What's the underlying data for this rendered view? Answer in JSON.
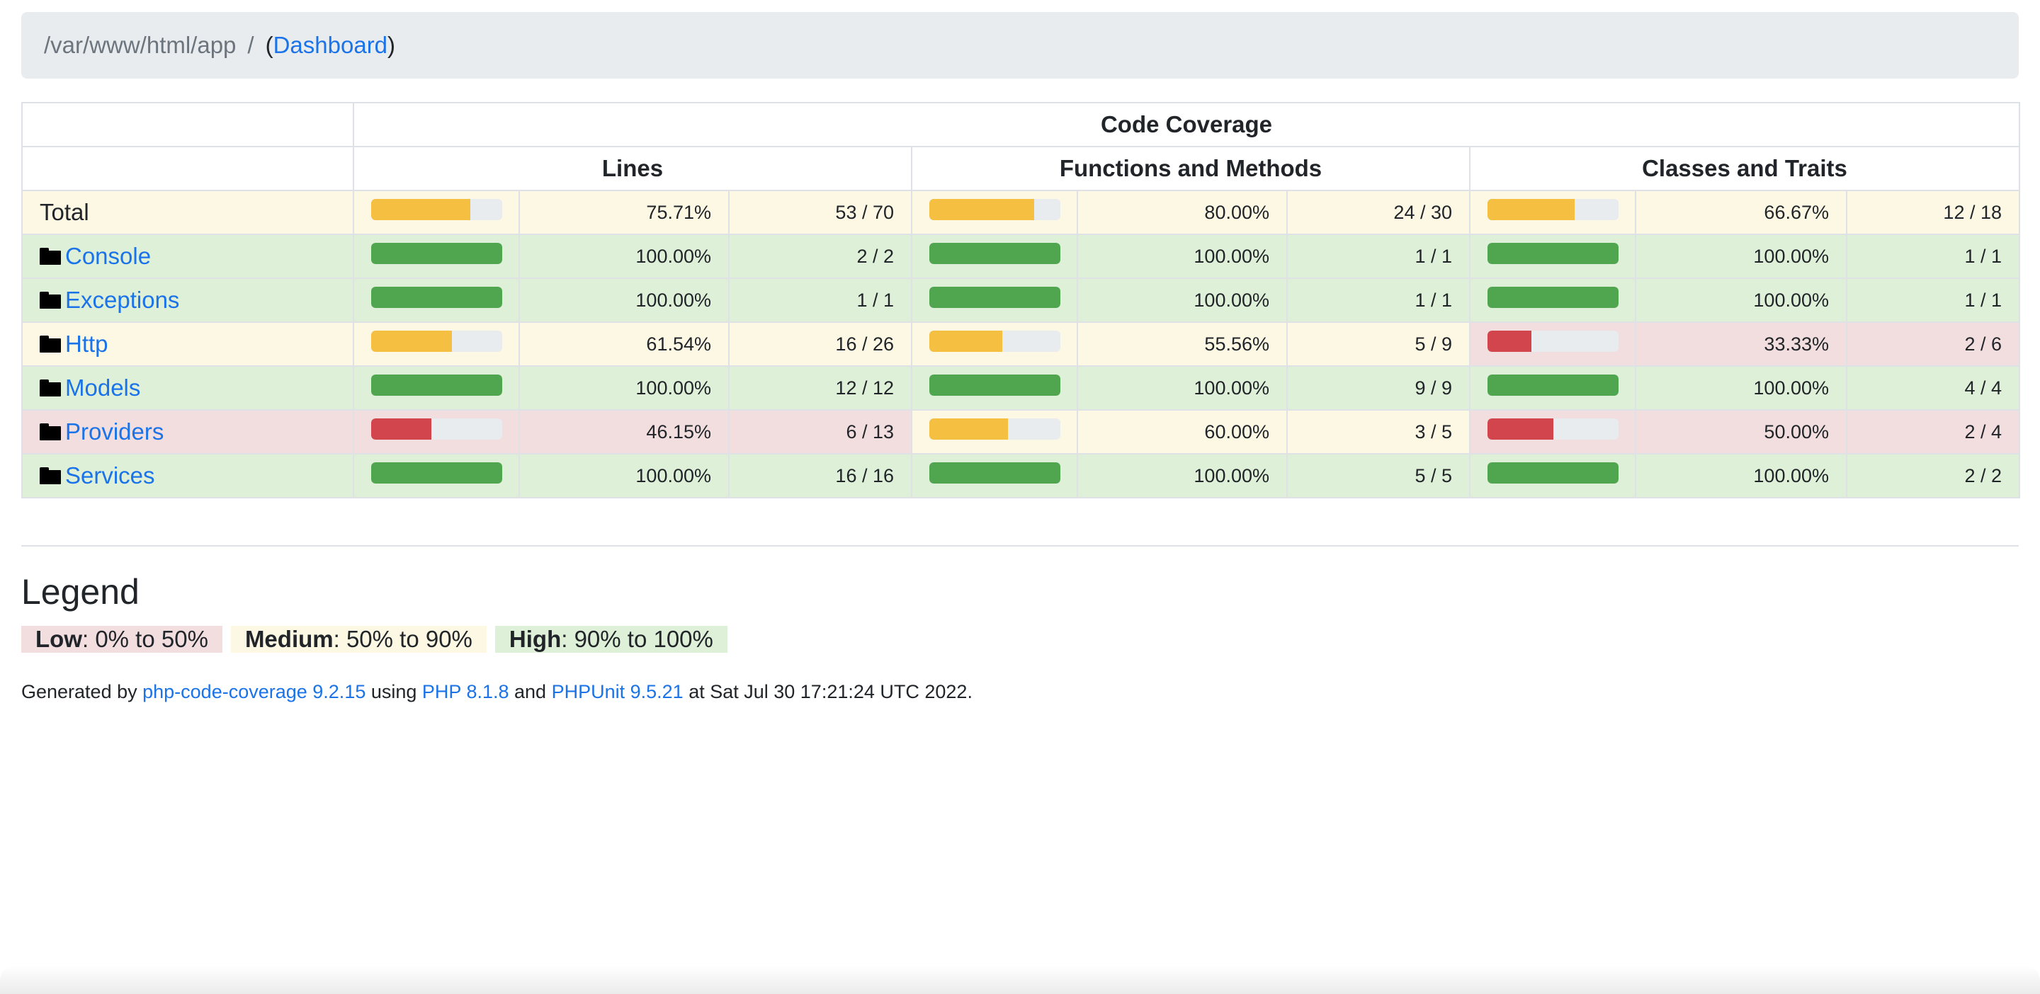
{
  "breadcrumb": {
    "path": "/var/www/html/app",
    "separator": "/",
    "open_paren": "(",
    "link_label": "Dashboard",
    "close_paren": ")"
  },
  "table": {
    "header_top": "Code Coverage",
    "header_cols": [
      "Lines",
      "Functions and Methods",
      "Classes and Traits"
    ],
    "rows": [
      {
        "name": "Total",
        "is_link": false,
        "lines": {
          "pct": "75.71%",
          "ratio": "53 / 70",
          "fill": 0.7571,
          "level": "medium"
        },
        "functions": {
          "pct": "80.00%",
          "ratio": "24 / 30",
          "fill": 0.8,
          "level": "medium"
        },
        "classes": {
          "pct": "66.67%",
          "ratio": "12 / 18",
          "fill": 0.6667,
          "level": "medium"
        }
      },
      {
        "name": "Console",
        "is_link": true,
        "lines": {
          "pct": "100.00%",
          "ratio": "2 / 2",
          "fill": 1.0,
          "level": "high"
        },
        "functions": {
          "pct": "100.00%",
          "ratio": "1 / 1",
          "fill": 1.0,
          "level": "high"
        },
        "classes": {
          "pct": "100.00%",
          "ratio": "1 / 1",
          "fill": 1.0,
          "level": "high"
        }
      },
      {
        "name": "Exceptions",
        "is_link": true,
        "lines": {
          "pct": "100.00%",
          "ratio": "1 / 1",
          "fill": 1.0,
          "level": "high"
        },
        "functions": {
          "pct": "100.00%",
          "ratio": "1 / 1",
          "fill": 1.0,
          "level": "high"
        },
        "classes": {
          "pct": "100.00%",
          "ratio": "1 / 1",
          "fill": 1.0,
          "level": "high"
        }
      },
      {
        "name": "Http",
        "is_link": true,
        "lines": {
          "pct": "61.54%",
          "ratio": "16 / 26",
          "fill": 0.6154,
          "level": "medium"
        },
        "functions": {
          "pct": "55.56%",
          "ratio": "5 / 9",
          "fill": 0.5556,
          "level": "medium"
        },
        "classes": {
          "pct": "33.33%",
          "ratio": "2 / 6",
          "fill": 0.3333,
          "level": "low"
        }
      },
      {
        "name": "Models",
        "is_link": true,
        "lines": {
          "pct": "100.00%",
          "ratio": "12 / 12",
          "fill": 1.0,
          "level": "high"
        },
        "functions": {
          "pct": "100.00%",
          "ratio": "9 / 9",
          "fill": 1.0,
          "level": "high"
        },
        "classes": {
          "pct": "100.00%",
          "ratio": "4 / 4",
          "fill": 1.0,
          "level": "high"
        }
      },
      {
        "name": "Providers",
        "is_link": true,
        "lines": {
          "pct": "46.15%",
          "ratio": "6 / 13",
          "fill": 0.4615,
          "level": "low"
        },
        "functions": {
          "pct": "60.00%",
          "ratio": "3 / 5",
          "fill": 0.6,
          "level": "medium"
        },
        "classes": {
          "pct": "50.00%",
          "ratio": "2 / 4",
          "fill": 0.5,
          "level": "low"
        }
      },
      {
        "name": "Services",
        "is_link": true,
        "lines": {
          "pct": "100.00%",
          "ratio": "16 / 16",
          "fill": 1.0,
          "level": "high"
        },
        "functions": {
          "pct": "100.00%",
          "ratio": "5 / 5",
          "fill": 1.0,
          "level": "high"
        },
        "classes": {
          "pct": "100.00%",
          "ratio": "2 / 2",
          "fill": 1.0,
          "level": "high"
        }
      }
    ]
  },
  "legend": {
    "title": "Legend",
    "items": [
      {
        "label": "Low",
        "range": ": 0% to 50%",
        "level": "low"
      },
      {
        "label": "Medium",
        "range": ": 50% to 90%",
        "level": "medium"
      },
      {
        "label": "High",
        "range": ": 90% to 100%",
        "level": "high"
      }
    ]
  },
  "footer": {
    "prefix": "Generated by ",
    "tool_link": "php-code-coverage 9.2.15",
    "using": " using ",
    "php_link": "PHP 8.1.8",
    "and": " and ",
    "phpunit_link": "PHPUnit 9.5.21",
    "suffix": " at Sat Jul 30 17:21:24 UTC 2022."
  },
  "colors": {
    "bar_high": "#4fa64f",
    "bar_medium": "#f5bf42",
    "bar_low": "#d3454c",
    "row_low": "#f2dede",
    "row_medium": "#fcf8e3",
    "row_high": "#dff0d8",
    "link": "#1a73e8"
  },
  "icons": {
    "folder": "folder-icon"
  }
}
